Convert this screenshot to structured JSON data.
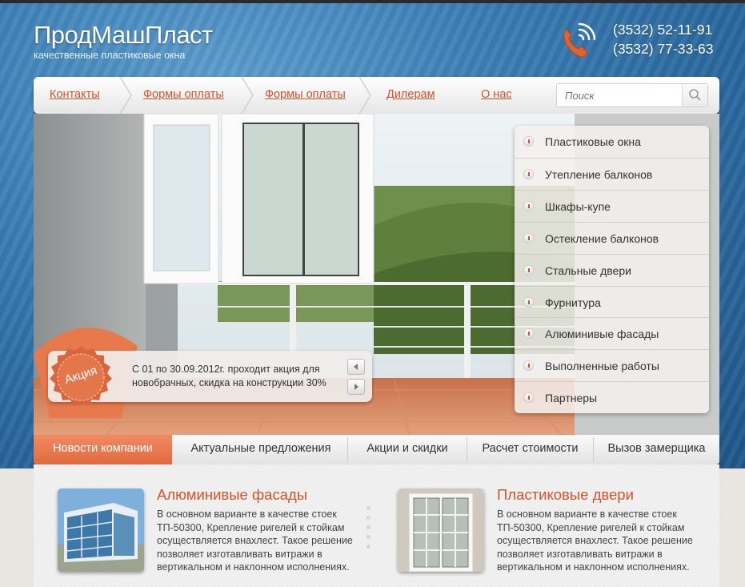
{
  "site": {
    "logo": "ПродМашПласт",
    "tagline": "качественные пластиковые окна",
    "phones": [
      "(3532) 52-11-91",
      "(3532) 77-33-63"
    ]
  },
  "nav": {
    "items": [
      "Контакты",
      "Формы оплаты",
      "Формы оплаты",
      "Дилерам",
      "О нас"
    ],
    "search_placeholder": "Поиск"
  },
  "sidebar": {
    "items": [
      "Пластиковые окна",
      "Утепление балконов",
      "Шкафы-купе",
      "Остекление балконов",
      "Стальные двери",
      "Фурнитура",
      "Алюминивые фасады",
      "Выполненные работы",
      "Партнеры"
    ]
  },
  "promo": {
    "badge": "Акция",
    "text": "С 01 по 30.09.2012г. проходит акция для новобрачных, скидка на конструкции 30%"
  },
  "tabs": [
    "Новости компании",
    "Актуальные предложения",
    "Акции и скидки",
    "Расчет стоимости",
    "Вызов замерщика"
  ],
  "cards": [
    {
      "title": "Алюминивые фасады",
      "text": "В основном варианте в качестве стоек ТП-50300, Крепление ригелей к стойкам осуществляется внахлест. Такое решение позволяет изготавливать витражи в вертикальном и наклонном исполнениях."
    },
    {
      "title": "Пластиковые двери",
      "text": "В основном варианте в качестве стоек ТП-50300, Крепление ригелей к стойкам осуществляется внахлест. Такое решение позволяет изготавливать витражи в вертикальном и наклонном исполнениях."
    }
  ],
  "colors": {
    "accent": "#d4532a",
    "accent_tab": "#e8764c",
    "header_blue": "#2f72aa"
  }
}
